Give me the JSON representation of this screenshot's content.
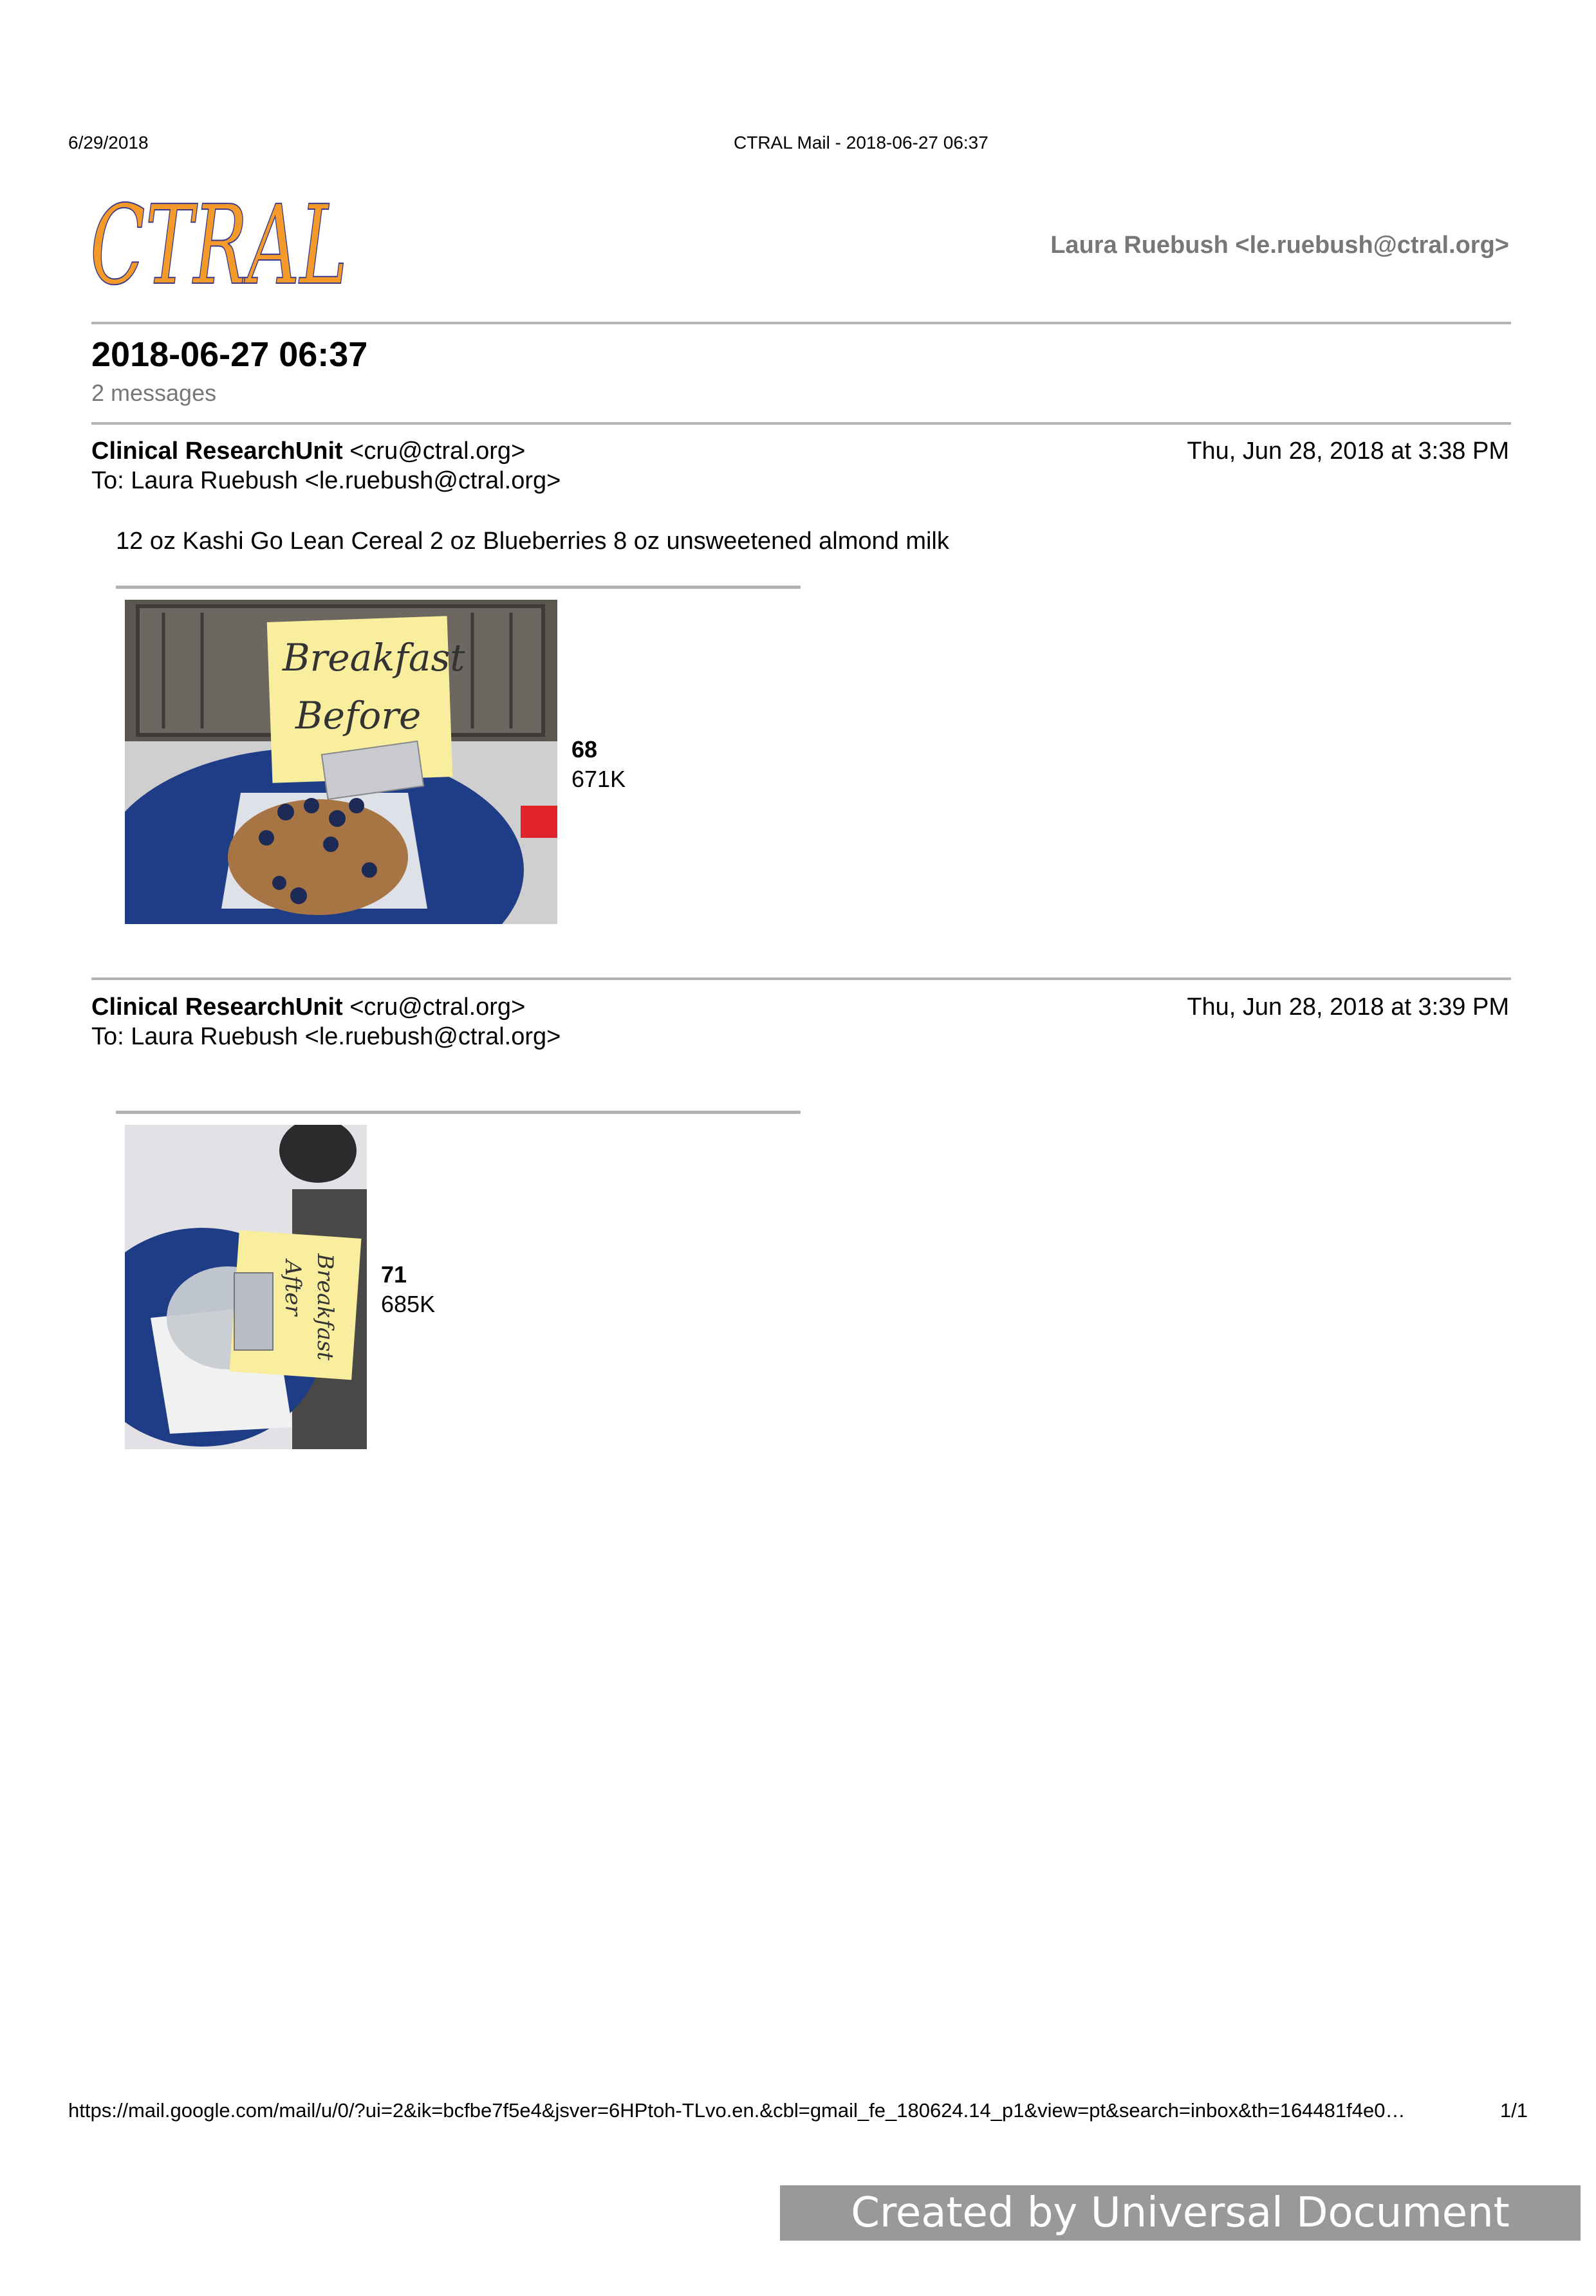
{
  "header": {
    "print_date": "6/29/2018",
    "print_title": "CTRAL Mail - 2018-06-27 06:37"
  },
  "logo": {
    "text": "CTRAL",
    "color": "#f39a2b",
    "outline": "#3a3a8a"
  },
  "account": "Laura Ruebush <le.ruebush@ctral.org>",
  "thread": {
    "title": "2018-06-27 06:37",
    "count": "2 messages"
  },
  "messages": [
    {
      "sender_name": "Clinical ResearchUnit",
      "sender_email": " <cru@ctral.org>",
      "to": "To: Laura Ruebush <le.ruebush@ctral.org>",
      "date": "Thu, Jun 28, 2018 at 3:38 PM",
      "body": "12 oz Kashi Go Lean Cereal 2 oz Blueberries 8 oz unsweetened almond milk",
      "attachment": {
        "name": "68",
        "size": "671K",
        "note_lines": [
          "Breakfast",
          "Before"
        ]
      }
    },
    {
      "sender_name": "Clinical ResearchUnit",
      "sender_email": " <cru@ctral.org>",
      "to": "To: Laura Ruebush <le.ruebush@ctral.org>",
      "date": "Thu, Jun 28, 2018 at 3:39 PM",
      "body": "",
      "attachment": {
        "name": "71",
        "size": "685K",
        "note_lines": [
          "Breakfast",
          "After"
        ]
      }
    }
  ],
  "footer": {
    "url": "https://mail.google.com/mail/u/0/?ui=2&ik=bcfbe7f5e4&jsver=6HPtoh-TLvo.en.&cbl=gmail_fe_180624.14_p1&view=pt&search=inbox&th=164481f4e0…",
    "page": "1/1"
  },
  "watermark": "Created by Universal Document Converter"
}
